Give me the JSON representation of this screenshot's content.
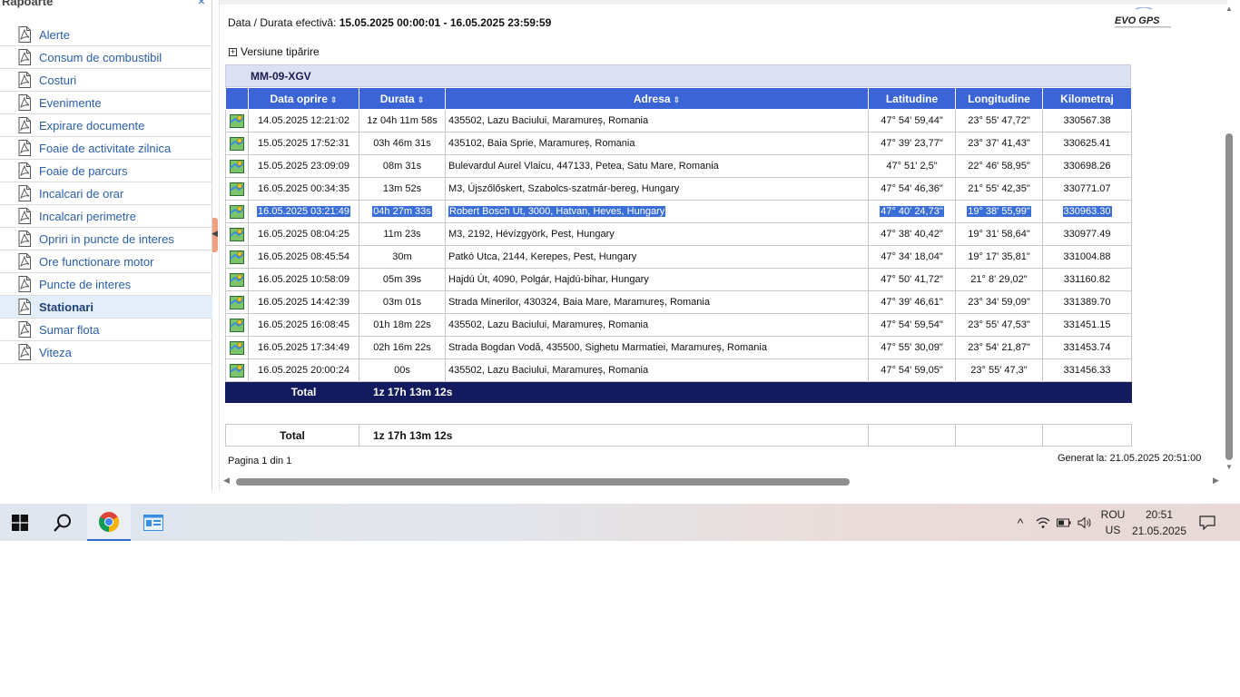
{
  "sidebar": {
    "title": "Rapoarte",
    "close_glyph": "×",
    "items": [
      {
        "label": "Alerte"
      },
      {
        "label": "Consum de combustibil"
      },
      {
        "label": "Costuri"
      },
      {
        "label": "Evenimente"
      },
      {
        "label": "Expirare documente"
      },
      {
        "label": "Foaie de activitate zilnica"
      },
      {
        "label": "Foaie de parcurs"
      },
      {
        "label": "Incalcari de orar"
      },
      {
        "label": "Incalcari perimetre"
      },
      {
        "label": "Opriri in puncte de interes"
      },
      {
        "label": "Ore functionare motor"
      },
      {
        "label": "Puncte de interes"
      },
      {
        "label": "Stationari"
      },
      {
        "label": "Sumar flota"
      },
      {
        "label": "Viteza"
      }
    ],
    "active_index": 12
  },
  "report": {
    "period_label": "Data / Durata efectivă:",
    "period_value": "15.05.2025 00:00:01 - 16.05.2025 23:59:59",
    "logo_text": "EVO GPS",
    "print_toggle_symbol": "+",
    "print_toggle_label": "Versiune tipărire",
    "vehicle": "MM-09-XGV",
    "columns": {
      "date": "Data oprire",
      "duration": "Durata",
      "address": "Adresa",
      "lat": "Latitudine",
      "lon": "Longitudine",
      "km": "Kilometraj"
    },
    "sort_glyph": "⇕",
    "rows": [
      {
        "date": "14.05.2025 12:21:02",
        "duration": "1z 04h 11m 58s",
        "address": "435502, Lazu Baciului, Maramureș, Romania",
        "lat": "47° 54' 59,44\"",
        "lon": "23° 55' 47,72\"",
        "km": "330567.38"
      },
      {
        "date": "15.05.2025 17:52:31",
        "duration": "03h 46m 31s",
        "address": "435102, Baia Sprie, Maramureș, Romania",
        "lat": "47° 39' 23,77\"",
        "lon": "23° 37' 41,43\"",
        "km": "330625.41"
      },
      {
        "date": "15.05.2025 23:09:09",
        "duration": "08m 31s",
        "address": "Bulevardul Aurel Vlaicu,  447133, Petea, Satu Mare, Romania",
        "lat": "47° 51' 2,5\"",
        "lon": "22° 46' 58,95\"",
        "km": "330698.26"
      },
      {
        "date": "16.05.2025 00:34:35",
        "duration": "13m 52s",
        "address": "M3,   Újszőlőskert, Szabolcs-szatmár-bereg, Hungary",
        "lat": "47° 54' 46,36\"",
        "lon": "21° 55' 42,35\"",
        "km": "330771.07"
      },
      {
        "date": "16.05.2025 03:21:49",
        "duration": "04h 27m 33s",
        "address": "Robert Bosch Út,  3000, Hatvan, Heves, Hungary",
        "lat": "47° 40' 24,73\"",
        "lon": "19° 38' 55,99\"",
        "km": "330963.30",
        "selected": "yes"
      },
      {
        "date": "16.05.2025 08:04:25",
        "duration": "11m 23s",
        "address": "M3,  2192, Hévízgyörk, Pest, Hungary",
        "lat": "47° 38' 40,42\"",
        "lon": "19° 31' 58,64\"",
        "km": "330977.49"
      },
      {
        "date": "16.05.2025 08:45:54",
        "duration": "30m",
        "address": "Patkó Utca,  2144, Kerepes, Pest, Hungary",
        "lat": "47° 34' 18,04\"",
        "lon": "19° 17' 35,81\"",
        "km": "331004.88"
      },
      {
        "date": "16.05.2025 10:58:09",
        "duration": "05m 39s",
        "address": "Hajdú Út,  4090, Polgár, Hajdú-bihar, Hungary",
        "lat": "47° 50' 41,72\"",
        "lon": "21° 8' 29,02\"",
        "km": "331160.82"
      },
      {
        "date": "16.05.2025 14:42:39",
        "duration": "03m 01s",
        "address": "Strada Minerilor,  430324, Baia Mare, Maramureș, Romania",
        "lat": "47° 39' 46,61\"",
        "lon": "23° 34' 59,09\"",
        "km": "331389.70"
      },
      {
        "date": "16.05.2025 16:08:45",
        "duration": "01h 18m 22s",
        "address": "435502, Lazu Baciului, Maramureș, Romania",
        "lat": "47° 54' 59,54\"",
        "lon": "23° 55' 47,53\"",
        "km": "331451.15"
      },
      {
        "date": "16.05.2025 17:34:49",
        "duration": "02h 16m 22s",
        "address": "Strada Bogdan Vodă,  435500, Sighetu Marmatiei, Maramureș, Romania",
        "lat": "47° 55' 30,09\"",
        "lon": "23° 54' 21,87\"",
        "km": "331453.74"
      },
      {
        "date": "16.05.2025 20:00:24",
        "duration": "00s",
        "address": "435502, Lazu Baciului, Maramureș, Romania",
        "lat": "47° 54' 59,05\"",
        "lon": "23° 55' 47,3\"",
        "km": "331456.33"
      }
    ],
    "total_label": "Total",
    "total_value": "1z 17h 13m 12s",
    "grand_total_label": "Total",
    "grand_total_value": "1z 17h 13m 12s",
    "pagination": "Pagina 1 din 1",
    "generated": "Generat la: 21.05.2025 20:51:00"
  },
  "scrollbar_glyphs": {
    "left": "◀",
    "right": "▶",
    "up": "▲",
    "down": "▼"
  },
  "taskbar": {
    "tray_up_glyph": "^",
    "lang_top": "ROU",
    "lang_bottom": "US",
    "time": "20:51",
    "date": "21.05.2025"
  },
  "colors": {
    "header_blue": "#3b65d6",
    "total_navy": "#131a5e",
    "selection": "#3a6fd8",
    "link": "#2a5fa8"
  }
}
